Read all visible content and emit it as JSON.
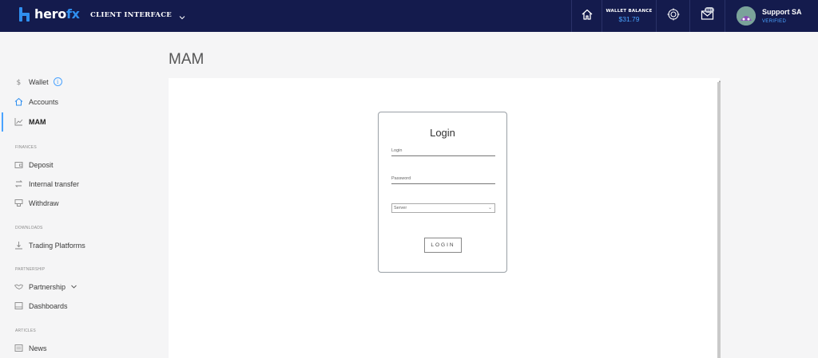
{
  "header": {
    "logo_part1": "hero",
    "logo_part2": "fx",
    "client_interface": "CLIENT INTERFACE",
    "wallet_label": "WALLET BALANCE",
    "wallet_value": "$31.79",
    "notification_badge": "99+",
    "user_name": "Support SA",
    "user_status": "VERIFIED"
  },
  "sidebar": {
    "items": [
      {
        "label": "Wallet"
      },
      {
        "label": "Accounts"
      },
      {
        "label": "MAM"
      }
    ],
    "finances": {
      "label": "FINANCES",
      "items": [
        {
          "label": "Deposit"
        },
        {
          "label": "Internal transfer"
        },
        {
          "label": "Withdraw"
        }
      ]
    },
    "downloads": {
      "label": "DOWNLOADS",
      "items": [
        {
          "label": "Trading Platforms"
        }
      ]
    },
    "partnership": {
      "label": "PARTNERSHIP",
      "items": [
        {
          "label": "Partnership"
        },
        {
          "label": "Dashboards"
        }
      ]
    },
    "articles": {
      "label": "ARTICLES",
      "items": [
        {
          "label": "News"
        }
      ]
    }
  },
  "main": {
    "title": "MAM",
    "login": {
      "title": "Login",
      "login_label": "Login",
      "password_label": "Password",
      "server_placeholder": "Server",
      "button_label": "LOGIN"
    }
  },
  "colors": {
    "topbar": "#141b4d",
    "accent": "#2f8ff0",
    "background": "#f5f5f6"
  }
}
